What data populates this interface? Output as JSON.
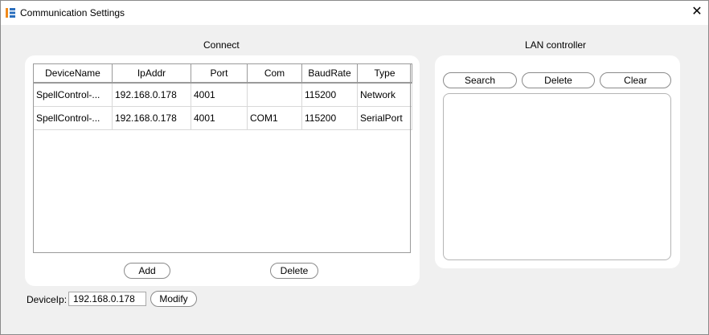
{
  "window": {
    "title": "Communication Settings",
    "close_glyph": "✕"
  },
  "connect": {
    "title": "Connect",
    "columns": [
      "DeviceName",
      "IpAddr",
      "Port",
      "Com",
      "BaudRate",
      "Type"
    ],
    "rows": [
      [
        "SpellControl-...",
        "192.168.0.178",
        "4001",
        "",
        "115200",
        "Network"
      ],
      [
        "SpellControl-...",
        "192.168.0.178",
        "4001",
        "COM1",
        "115200",
        "SerialPort"
      ]
    ],
    "add_label": "Add",
    "delete_label": "Delete"
  },
  "lan": {
    "title": "LAN controller",
    "search_label": "Search",
    "delete_label": "Delete",
    "clear_label": "Clear"
  },
  "device_ip": {
    "label": "DeviceIp:",
    "value": "192.168.0.178",
    "modify_label": "Modify"
  }
}
